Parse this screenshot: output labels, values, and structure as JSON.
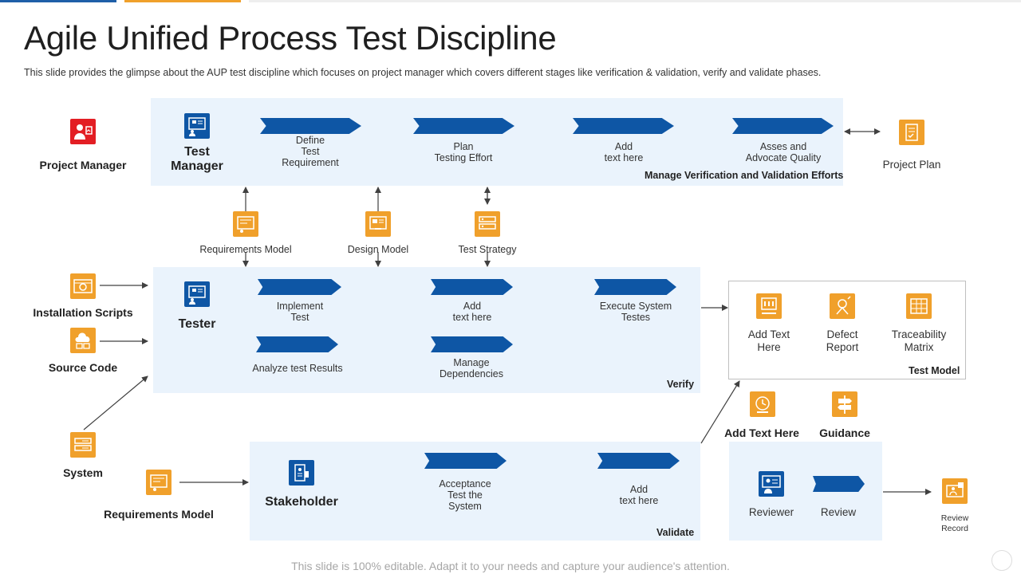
{
  "colors": {
    "blue": "#0e56a5",
    "orange": "#f0a02b",
    "red": "#e31e24",
    "panel": "#eaf3fc",
    "arrow": "#404040"
  },
  "header": {
    "title": "Agile Unified Process Test Discipline",
    "subtitle": "This slide provides  the glimpse about the AUP test discipline which focuses on project manager which covers different  stages like verification  & validation,  verify  and validate  phases."
  },
  "left": {
    "project_manager": "Project Manager",
    "installation_scripts": "Installation Scripts",
    "source_code": "Source Code",
    "system": "System",
    "requirements_model": "Requirements Model"
  },
  "test_manager": {
    "role": "Test\nManager",
    "steps": [
      "Define\nTest\nRequirement",
      "Plan\nTesting Effort",
      "Add\ntext here",
      "Asses and\nAdvocate Quality"
    ],
    "footer": "Manage Verification and Validation Efforts",
    "output": "Project Plan"
  },
  "artifacts": [
    "Requirements Model",
    "Design Model",
    "Test Strategy"
  ],
  "tester": {
    "role": "Tester",
    "steps": [
      "Implement\nTest",
      "Add\ntext here",
      "Execute System\nTestes",
      "Analyze test Results",
      "Manage\nDependencies"
    ],
    "footer": "Verify"
  },
  "test_model": {
    "items": [
      "Add Text\nHere",
      "Defect\nReport",
      "Traceability\nMatrix"
    ],
    "footer": "Test Model"
  },
  "extras": {
    "add_text_here": "Add Text Here",
    "guidance": "Guidance"
  },
  "stakeholder": {
    "role": "Stakeholder",
    "steps": [
      "Acceptance\nTest the\nSystem",
      "Add\ntext here"
    ],
    "footer": "Validate"
  },
  "review": {
    "reviewer": "Reviewer",
    "review": "Review",
    "record": "Review\nRecord"
  },
  "footer": "This slide is 100% editable. Adapt it to your needs and capture your audience's attention.",
  "icons": [
    "project-manager-icon",
    "test-manager-icon",
    "tester-icon",
    "stakeholder-icon",
    "reviewer-icon",
    "project-plan-icon",
    "requirements-model-icon",
    "design-model-icon",
    "test-strategy-icon",
    "installation-scripts-icon",
    "source-code-icon",
    "system-icon",
    "add-text-icon",
    "defect-report-icon",
    "traceability-matrix-icon",
    "guidance-icon",
    "review-record-icon"
  ]
}
